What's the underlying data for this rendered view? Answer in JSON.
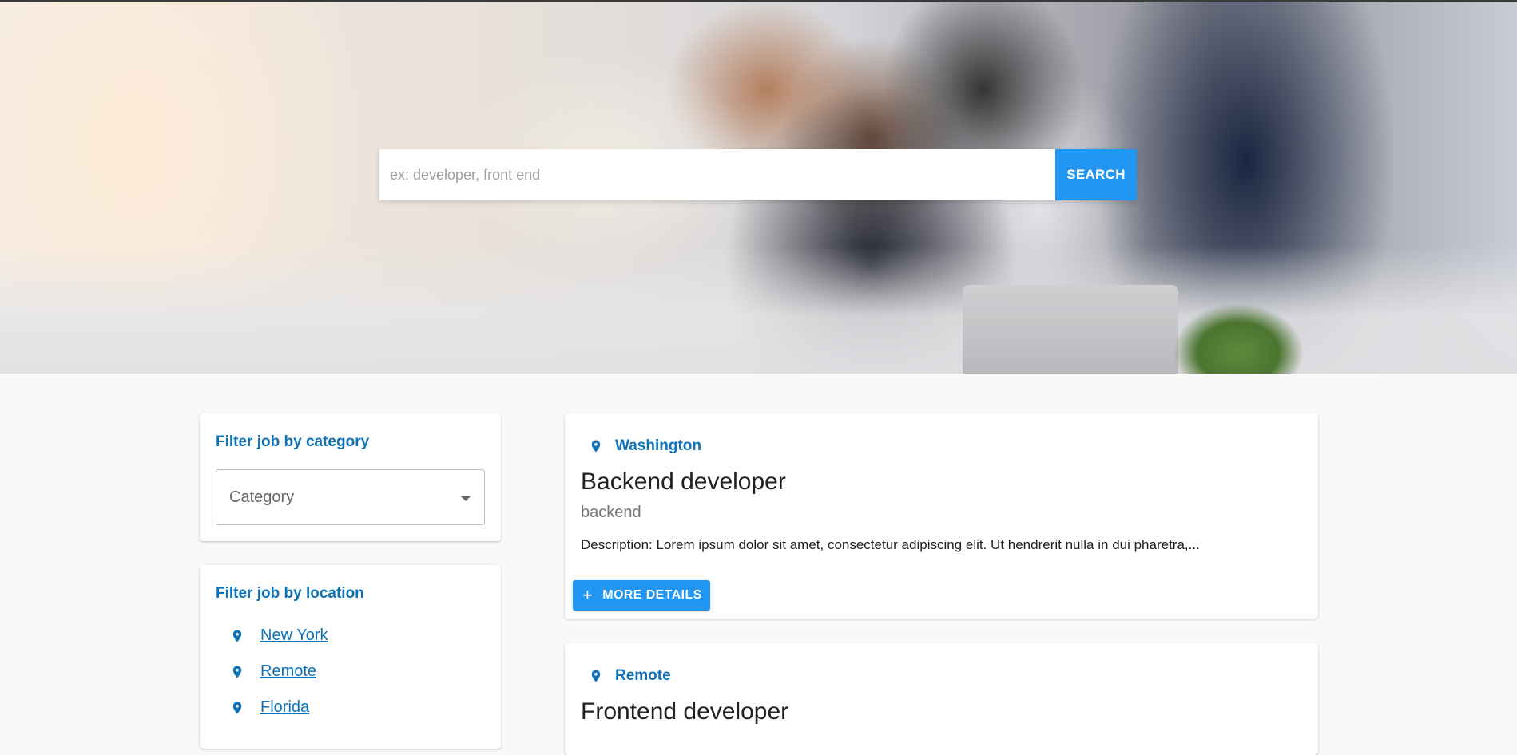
{
  "search": {
    "placeholder": "ex: developer, front end",
    "button_label": "SEARCH"
  },
  "category_filter": {
    "title": "Filter job by category",
    "select_label": "Category"
  },
  "location_filter": {
    "title": "Filter job by location",
    "locations": [
      "New York",
      "Remote",
      "Florida"
    ]
  },
  "jobs": [
    {
      "location": "Washington",
      "title": "Backend developer",
      "category": "backend",
      "description": "Description: Lorem ipsum dolor sit amet, consectetur adipiscing elit. Ut hendrerit nulla in dui pharetra,...",
      "details_label": "MORE DETAILS"
    },
    {
      "location": "Remote",
      "title": "Frontend developer"
    }
  ],
  "icons": {
    "location": "location-pin-icon",
    "plus": "plus-icon",
    "dropdown": "chevron-down-icon"
  },
  "colors": {
    "primary": "#2196f3",
    "link": "#0e72b8"
  }
}
